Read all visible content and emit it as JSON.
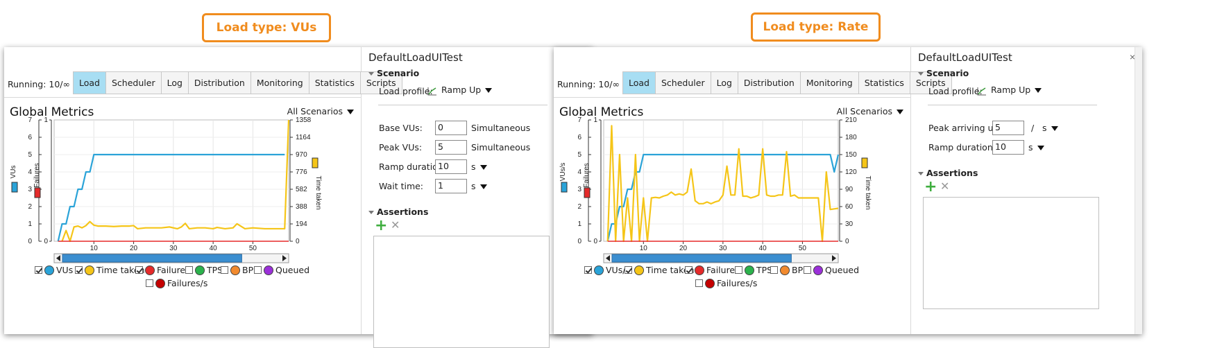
{
  "callouts": {
    "left": "Load type: VUs",
    "right": "Load type: Rate"
  },
  "colors": {
    "vus": "#2aa3d8",
    "time_taken": "#f5c518",
    "failures": "#e52a2a",
    "tps": "#2bb24c",
    "bps": "#f28a2e",
    "queued": "#9b30d9",
    "failures_s": "#c40000",
    "active_tab": "#a8def3",
    "callout": "#f08c1e"
  },
  "panels": [
    {
      "running": "Running: 10/∞",
      "tabs": [
        "Load",
        "Scheduler",
        "Log",
        "Distribution",
        "Monitoring",
        "Statistics",
        "Scripts"
      ],
      "active_tab": 0,
      "chart_title": "Global Metrics",
      "scenario_select": "All Scenarios",
      "y_left_label": "VUs",
      "y_fail_label": "Failures",
      "y_right_label": "Time taken",
      "legend": [
        {
          "label": "VUs",
          "checked": true,
          "color_key": "vus"
        },
        {
          "label": "Time taken",
          "checked": true,
          "color_key": "time_taken"
        },
        {
          "label": "Failures",
          "checked": true,
          "color_key": "failures"
        },
        {
          "label": "TPS",
          "checked": false,
          "color_key": "tps"
        },
        {
          "label": "BPS",
          "checked": false,
          "color_key": "bps"
        },
        {
          "label": "Queued",
          "checked": false,
          "color_key": "queued"
        },
        {
          "label": "Failures/s",
          "checked": false,
          "color_key": "failures_s"
        }
      ],
      "right": {
        "title": "DefaultLoadUITest",
        "close": "×",
        "scenario_header": "Scenario",
        "load_profile_label": "Load profile:",
        "load_profile_value": "Ramp Up",
        "fields": [
          {
            "label": "Base VUs:",
            "value": "0",
            "unit": "Simultaneous",
            "unit_dropdown": false
          },
          {
            "label": "Peak VUs:",
            "value": "5",
            "unit": "Simultaneous",
            "unit_dropdown": false
          },
          {
            "label": "Ramp duration:",
            "value": "10",
            "unit": "s",
            "unit_dropdown": true
          },
          {
            "label": "Wait time:",
            "value": "1",
            "unit": "s",
            "unit_dropdown": true
          }
        ],
        "assertions_header": "Assertions"
      }
    },
    {
      "running": "Running: 10/∞",
      "tabs": [
        "Load",
        "Scheduler",
        "Log",
        "Distribution",
        "Monitoring",
        "Statistics",
        "Scripts"
      ],
      "active_tab": 0,
      "chart_title": "Global Metrics",
      "scenario_select": "All Scenarios",
      "y_left_label": "VUs/s",
      "y_fail_label": "Failures",
      "y_right_label": "Time taken",
      "legend": [
        {
          "label": "VUs/s",
          "checked": true,
          "color_key": "vus"
        },
        {
          "label": "Time taken",
          "checked": true,
          "color_key": "time_taken"
        },
        {
          "label": "Failures",
          "checked": true,
          "color_key": "failures"
        },
        {
          "label": "TPS",
          "checked": false,
          "color_key": "tps"
        },
        {
          "label": "BPS",
          "checked": false,
          "color_key": "bps"
        },
        {
          "label": "Queued",
          "checked": false,
          "color_key": "queued"
        },
        {
          "label": "Failures/s",
          "checked": false,
          "color_key": "failures_s"
        }
      ],
      "right": {
        "title": "DefaultLoadUITest",
        "close": "×",
        "scenario_header": "Scenario",
        "load_profile_label": "Load profile:",
        "load_profile_value": "Ramp Up",
        "fields": [
          {
            "label": "Peak arriving users:",
            "value": "5",
            "unit": "s",
            "per": "/",
            "unit_dropdown": true
          },
          {
            "label": "Ramp duration:",
            "value": "10",
            "unit": "s",
            "unit_dropdown": true
          }
        ],
        "assertions_header": "Assertions"
      }
    }
  ],
  "chart_data": [
    {
      "type": "line",
      "title": "Global Metrics",
      "xlim": [
        0,
        59
      ],
      "x_ticks": [
        "10",
        "20",
        "30",
        "40",
        "50"
      ],
      "x_tick_values": [
        10,
        20,
        30,
        40,
        50
      ],
      "y_left": {
        "label": "VUs",
        "range": [
          0,
          7
        ],
        "ticks": [
          "0",
          "1",
          "2",
          "3",
          "4",
          "5",
          "6",
          "7"
        ]
      },
      "y_failures": {
        "label": "Failures",
        "range": [
          0,
          1
        ],
        "ticks": [
          "0",
          "1"
        ]
      },
      "y_right": {
        "label": "Time taken",
        "range": [
          0,
          1358
        ],
        "ticks": [
          "0",
          "194",
          "388",
          "582",
          "776",
          "970",
          "1164",
          "1358"
        ]
      },
      "series": [
        {
          "name": "VUs",
          "axis": "left",
          "color_key": "vus",
          "x": [
            1,
            2,
            3,
            4,
            5,
            6,
            7,
            8,
            9,
            10,
            58
          ],
          "y": [
            0,
            1,
            1,
            2,
            2,
            3,
            3,
            4,
            4,
            5,
            5
          ]
        },
        {
          "name": "Time taken",
          "axis": "right",
          "color_key": "time_taken",
          "x": [
            2,
            3,
            4,
            5,
            6,
            7,
            8,
            9,
            10,
            11,
            13,
            15,
            17,
            19,
            20,
            21,
            23,
            25,
            27,
            29,
            31,
            32,
            33,
            34,
            36,
            38,
            40,
            41,
            43,
            45,
            46,
            48,
            50,
            53,
            55,
            57,
            58,
            59
          ],
          "y": [
            0,
            120,
            0,
            160,
            170,
            150,
            175,
            220,
            180,
            170,
            170,
            165,
            170,
            170,
            175,
            140,
            150,
            150,
            150,
            160,
            140,
            160,
            200,
            140,
            150,
            150,
            140,
            155,
            140,
            150,
            195,
            140,
            150,
            140,
            140,
            140,
            140,
            1358
          ]
        },
        {
          "name": "Failures",
          "axis": "failures",
          "color_key": "failures",
          "x": [
            1,
            59
          ],
          "y": [
            0,
            0
          ]
        }
      ],
      "grid": true,
      "legend_position": "bottom"
    },
    {
      "type": "line",
      "title": "Global Metrics",
      "xlim": [
        0,
        59
      ],
      "x_ticks": [
        "10",
        "20",
        "30",
        "40",
        "50"
      ],
      "x_tick_values": [
        10,
        20,
        30,
        40,
        50
      ],
      "y_left": {
        "label": "VUs/s",
        "range": [
          0,
          7
        ],
        "ticks": [
          "0",
          "1",
          "2",
          "3",
          "4",
          "5",
          "6",
          "7"
        ]
      },
      "y_failures": {
        "label": "Failures",
        "range": [
          0,
          1
        ],
        "ticks": [
          "0",
          "1"
        ]
      },
      "y_right": {
        "label": "Time taken",
        "range": [
          0,
          210
        ],
        "ticks": [
          "0",
          "30",
          "60",
          "90",
          "120",
          "150",
          "180",
          "210"
        ]
      },
      "series": [
        {
          "name": "VUs/s",
          "axis": "left",
          "color_key": "vus",
          "x": [
            1,
            2,
            3,
            4,
            5,
            6,
            7,
            8,
            9,
            10,
            57,
            58,
            59
          ],
          "y": [
            0,
            1,
            1,
            2,
            2,
            3,
            3,
            4,
            4,
            5,
            5,
            4,
            5
          ]
        },
        {
          "name": "Time taken",
          "axis": "right",
          "color_key": "time_taken",
          "x": [
            1,
            2,
            3,
            4,
            5,
            6,
            7,
            8,
            9,
            10,
            11,
            12,
            13,
            14,
            15,
            16,
            17,
            18,
            19,
            20,
            21,
            22,
            23,
            24,
            25,
            26,
            27,
            28,
            29,
            30,
            31,
            32,
            33,
            34,
            35,
            36,
            37,
            38,
            39,
            40,
            41,
            42,
            43,
            44,
            45,
            46,
            47,
            48,
            49,
            50,
            51,
            52,
            53,
            54,
            55,
            56,
            57,
            58,
            59
          ],
          "y": [
            0,
            200,
            0,
            150,
            0,
            75,
            0,
            150,
            0,
            75,
            0,
            75,
            76,
            75,
            78,
            80,
            85,
            80,
            82,
            80,
            85,
            125,
            70,
            65,
            65,
            68,
            65,
            68,
            70,
            80,
            130,
            80,
            80,
            160,
            78,
            78,
            75,
            77,
            80,
            160,
            80,
            78,
            78,
            80,
            80,
            155,
            78,
            80,
            75,
            75,
            75,
            75,
            75,
            75,
            0,
            120,
            55,
            56,
            57
          ]
        },
        {
          "name": "Failures",
          "axis": "failures",
          "color_key": "failures",
          "x": [
            1,
            59
          ],
          "y": [
            0,
            0
          ]
        }
      ],
      "grid": true,
      "legend_position": "bottom"
    }
  ]
}
